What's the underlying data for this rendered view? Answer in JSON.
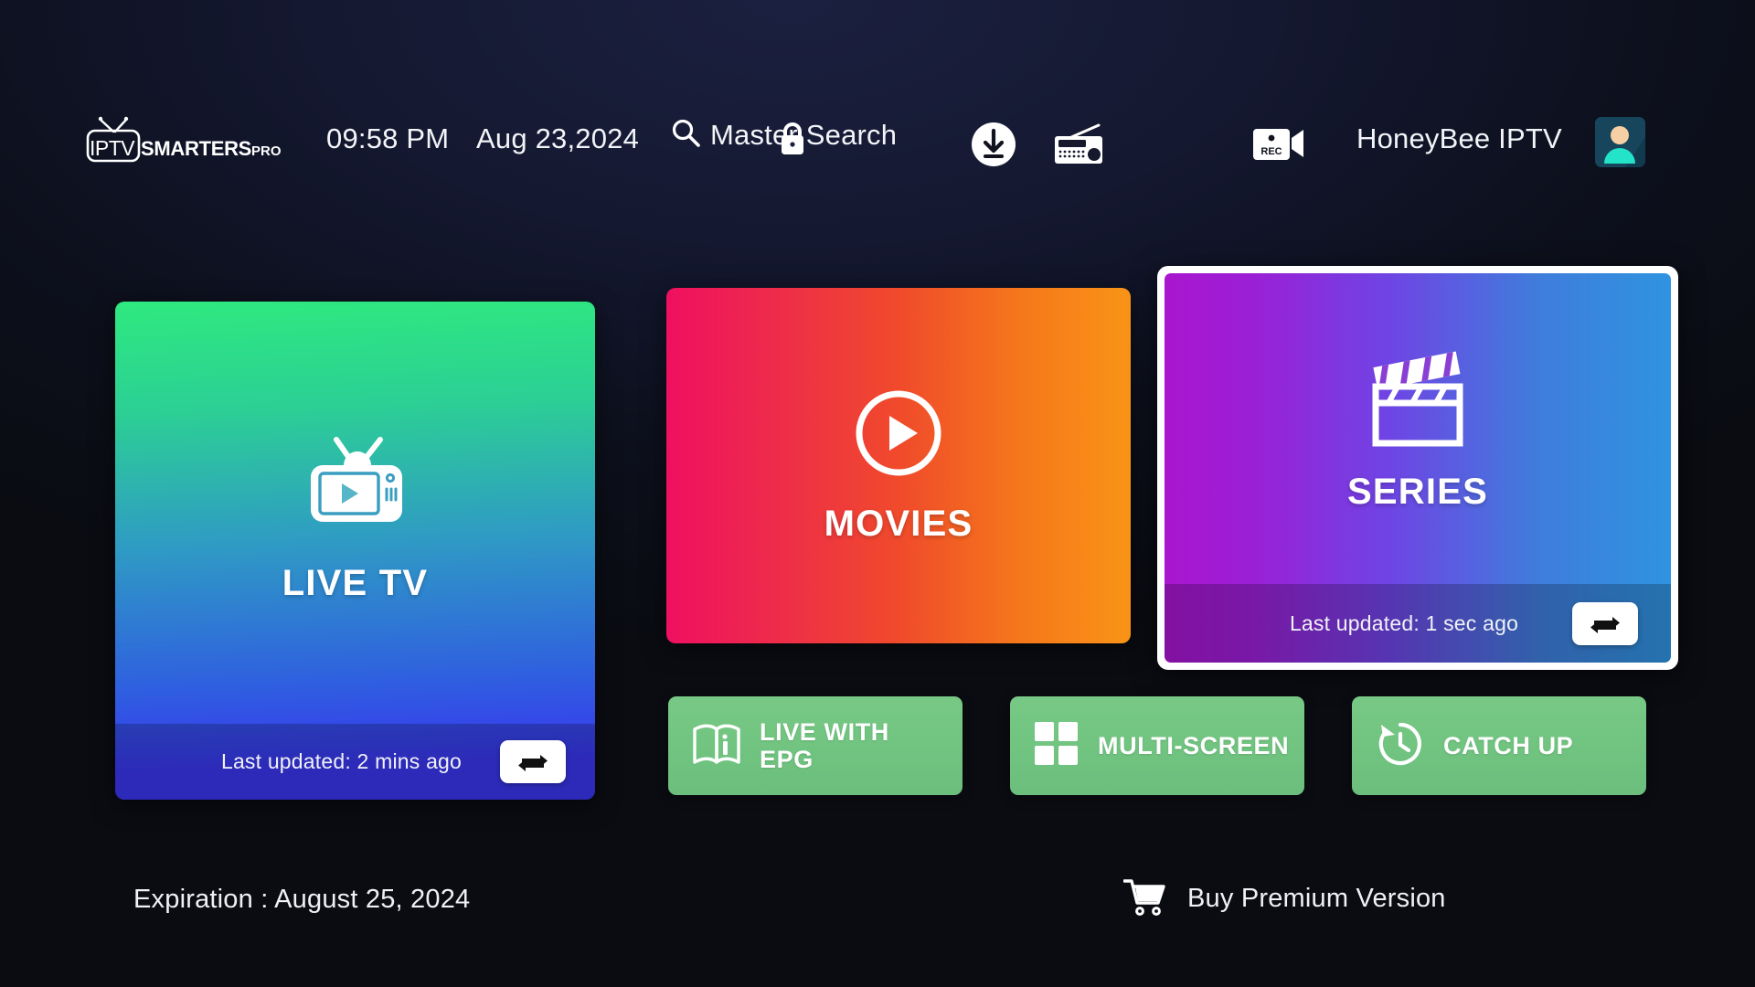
{
  "app": {
    "logo_primary": "IPTV",
    "logo_secondary": "SMARTERS",
    "logo_tertiary": "PRO"
  },
  "topbar": {
    "time": "09:58 PM",
    "date": "Aug 23,2024",
    "search_label": "Master Search",
    "search_icon": "search-icon",
    "lock_icon": "lock-icon",
    "download_icon": "download-icon",
    "radio_icon": "radio-icon",
    "recording_icon": "rec-camera-icon",
    "username": "HoneyBee IPTV",
    "avatar_icon": "user-avatar-icon"
  },
  "cards": [
    {
      "id": "live",
      "title": "LIVE TV",
      "icon": "tv-icon",
      "last_updated": "Last updated: 2 mins ago",
      "refresh_icon": "refresh-loop-icon",
      "focused": false,
      "gradient_from": "#2ee97f",
      "gradient_to": "#3a36ef"
    },
    {
      "id": "movies",
      "title": "MOVIES",
      "icon": "play-circle-icon",
      "last_updated": "",
      "refresh_icon": "",
      "focused": false,
      "gradient_from": "#ef1060",
      "gradient_to": "#f99417"
    },
    {
      "id": "series",
      "title": "SERIES",
      "icon": "clapperboard-icon",
      "last_updated": "Last updated: 1 sec ago",
      "refresh_icon": "refresh-loop-icon",
      "focused": true,
      "gradient_from": "#a916cf",
      "gradient_to": "#2f93e0"
    }
  ],
  "quick_buttons": [
    {
      "id": "epg",
      "label": "LIVE WITH\nEPG",
      "label_line1": "LIVE WITH",
      "label_line2": "EPG",
      "icon": "book-info-icon"
    },
    {
      "id": "multi",
      "label": "MULTI-SCREEN",
      "icon": "grid-four-icon"
    },
    {
      "id": "catchup",
      "label": "CATCH UP",
      "icon": "history-clock-icon"
    }
  ],
  "footer": {
    "expiration": "Expiration : August 25, 2024",
    "buy_label": "Buy Premium Version",
    "cart_icon": "shopping-cart-icon"
  },
  "colors": {
    "background_top": "#1b2040",
    "background_bottom": "#0a0c12",
    "green_button": "#6cbe7c",
    "focus_border": "#ffffff"
  }
}
